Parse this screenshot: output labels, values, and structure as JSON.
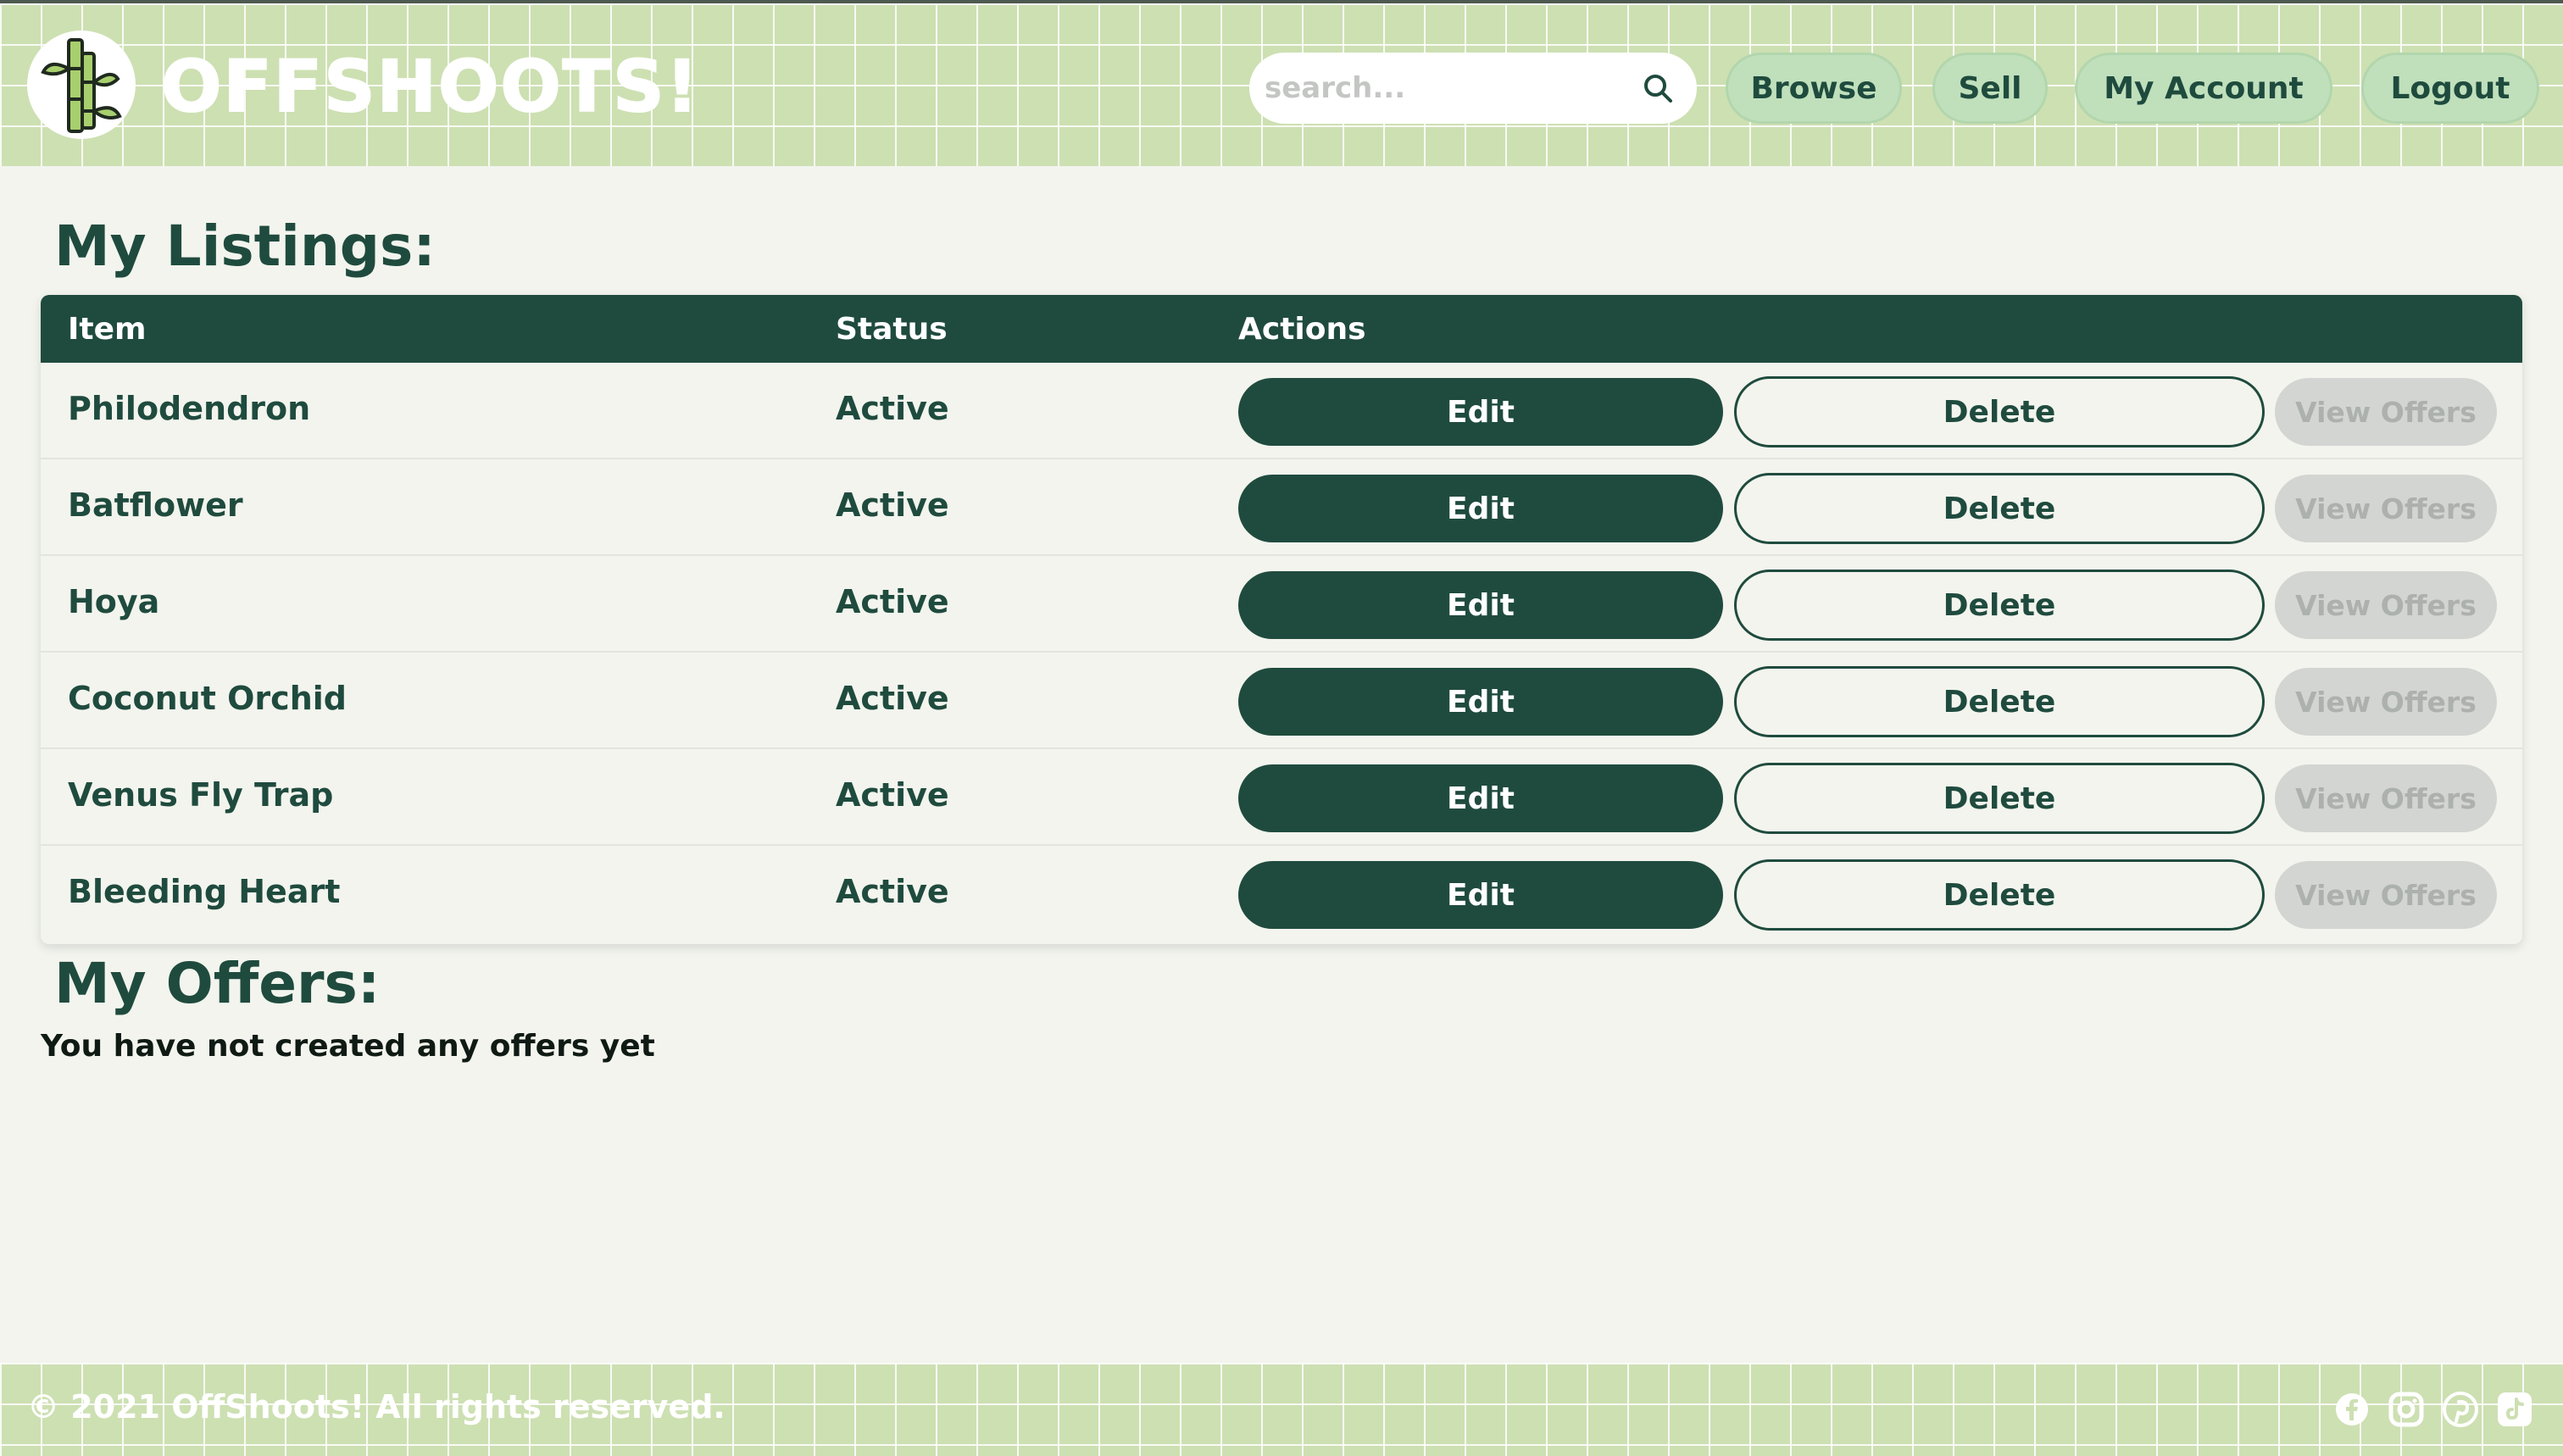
{
  "header": {
    "brand": "OFFSHOOTS!",
    "search_placeholder": "search...",
    "nav": {
      "browse": "Browse",
      "sell": "Sell",
      "account": "My Account",
      "logout": "Logout"
    }
  },
  "listings": {
    "title": "My Listings:",
    "columns": {
      "item": "Item",
      "status": "Status",
      "actions": "Actions"
    },
    "rows": [
      {
        "item": "Philodendron",
        "status": "Active",
        "edit": "Edit",
        "delete": "Delete",
        "offers": "View Offers"
      },
      {
        "item": "Batflower",
        "status": "Active",
        "edit": "Edit",
        "delete": "Delete",
        "offers": "View Offers"
      },
      {
        "item": "Hoya",
        "status": "Active",
        "edit": "Edit",
        "delete": "Delete",
        "offers": "View Offers"
      },
      {
        "item": "Coconut Orchid",
        "status": "Active",
        "edit": "Edit",
        "delete": "Delete",
        "offers": "View Offers"
      },
      {
        "item": "Venus Fly Trap",
        "status": "Active",
        "edit": "Edit",
        "delete": "Delete",
        "offers": "View Offers"
      },
      {
        "item": "Bleeding Heart",
        "status": "Active",
        "edit": "Edit",
        "delete": "Delete",
        "offers": "View Offers"
      }
    ]
  },
  "offers": {
    "title": "My Offers:",
    "empty_message": "You have not created any offers yet"
  },
  "footer": {
    "copyright": "© 2021 OffShoots! All rights reserved.",
    "social_icons": [
      "facebook-icon",
      "instagram-icon",
      "pinterest-icon",
      "tiktok-icon"
    ]
  },
  "colors": {
    "header_green": "#cde0b2",
    "dark_green": "#1f4b3e",
    "page_bg": "#f3f4ee",
    "nav_button": "#c0e0bc",
    "disabled_button": "#d3d5d2"
  }
}
